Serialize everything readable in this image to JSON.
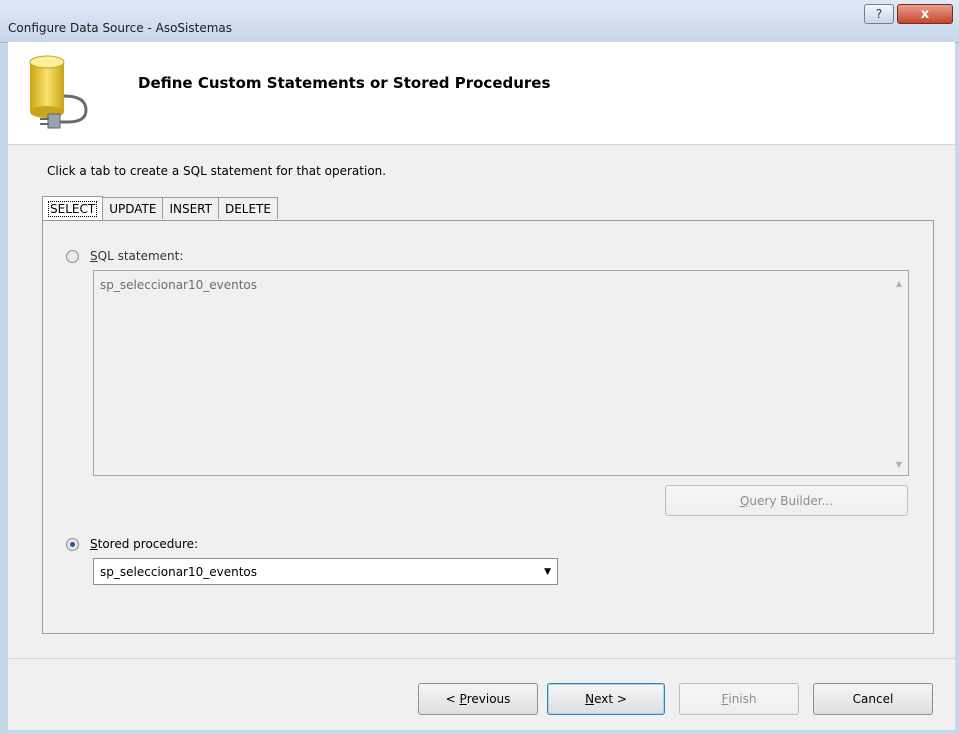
{
  "window": {
    "title": "Configure Data Source - AsoSistemas",
    "help_glyph": "?",
    "close_glyph": "x"
  },
  "header": {
    "title": "Define Custom Statements or Stored Procedures",
    "icon": "database-plug-icon"
  },
  "instruction": "Click a tab to create a SQL statement for that operation.",
  "tabs": [
    {
      "label": "SELECT",
      "active": true
    },
    {
      "label": "UPDATE",
      "active": false
    },
    {
      "label": "INSERT",
      "active": false
    },
    {
      "label": "DELETE",
      "active": false
    }
  ],
  "sql_option": {
    "label_accel": "S",
    "label_rest": "QL statement:",
    "selected": false,
    "value": "sp_seleccionar10_eventos"
  },
  "query_builder": {
    "label_accel": "Q",
    "label_rest": "uery Builder...",
    "enabled": false
  },
  "stored_proc_option": {
    "label_accel": "S",
    "label_rest": "tored procedure:",
    "selected": true,
    "selected_value": "sp_seleccionar10_eventos"
  },
  "buttons": {
    "previous": {
      "prefix": "< ",
      "accel": "P",
      "rest": "revious"
    },
    "next": {
      "accel": "N",
      "rest": "ext >"
    },
    "finish": {
      "accel": "F",
      "rest": "inish",
      "enabled": false
    },
    "cancel": {
      "label": "Cancel"
    }
  },
  "colors": {
    "accent": "#2a56a6",
    "close_button": "#c5462b"
  }
}
